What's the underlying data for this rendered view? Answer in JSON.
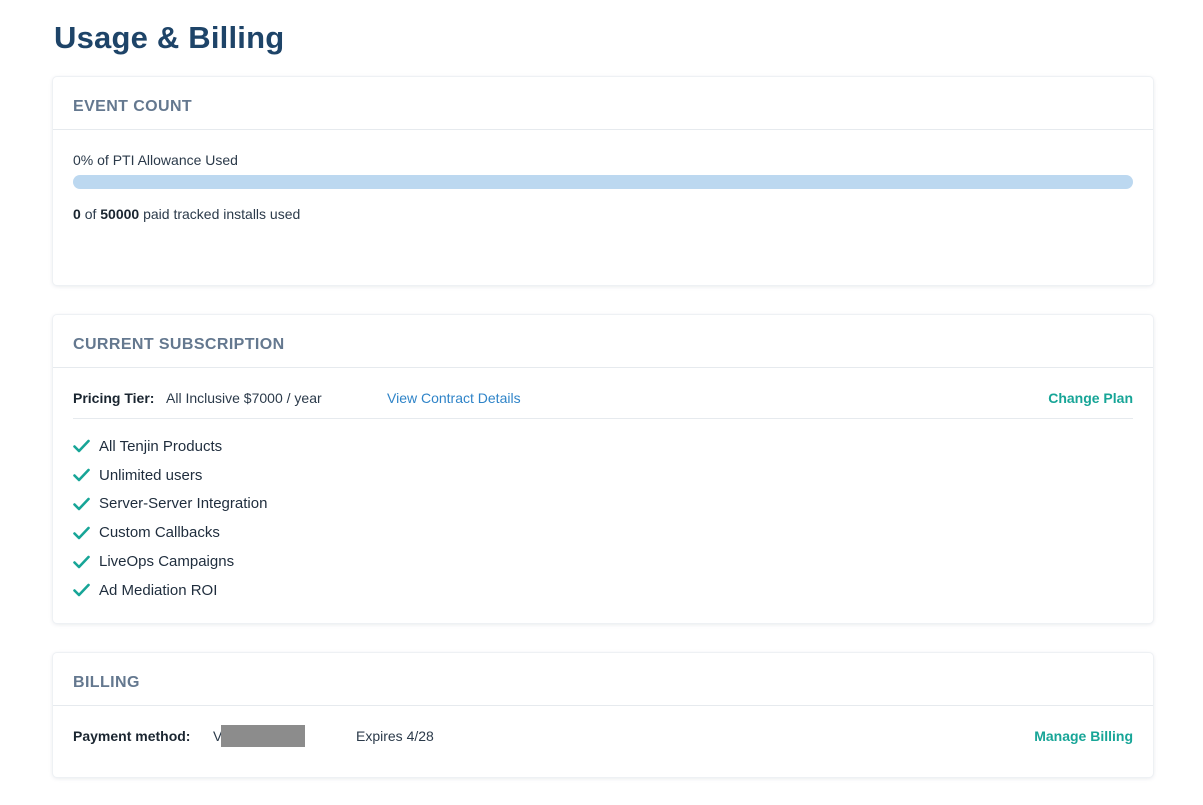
{
  "page": {
    "title": "Usage & Billing"
  },
  "event_count": {
    "header": "EVENT COUNT",
    "allowance_label": "0% of PTI Allowance Used",
    "allowance_percent": 0,
    "used": "0",
    "of_text": "of",
    "limit": "50000",
    "suffix": "paid tracked installs used"
  },
  "subscription": {
    "header": "CURRENT SUBSCRIPTION",
    "tier_label": "Pricing Tier:",
    "tier_value": "All Inclusive $7000 / year",
    "contract_link": "View Contract Details",
    "change_plan": "Change Plan",
    "features": [
      "All Tenjin Products",
      "Unlimited users",
      "Server-Server Integration",
      "Custom Callbacks",
      "LiveOps Campaigns",
      "Ad Mediation ROI"
    ]
  },
  "billing": {
    "header": "BILLING",
    "payment_label": "Payment method:",
    "payment_value": "V",
    "expires": "Expires 4/28",
    "manage": "Manage Billing"
  },
  "colors": {
    "title": "#1e4468",
    "accent_teal": "#17a597",
    "link_blue": "#2f84c8",
    "progress_track": "#bcd8f0"
  },
  "icons": {
    "feature_check": "check-icon"
  }
}
